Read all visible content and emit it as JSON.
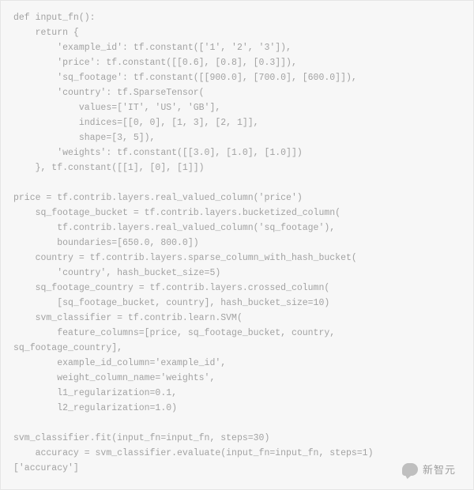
{
  "code_lines": [
    "def input_fn():",
    "    return {",
    "        'example_id': tf.constant(['1', '2', '3']),",
    "        'price': tf.constant([[0.6], [0.8], [0.3]]),",
    "        'sq_footage': tf.constant([[900.0], [700.0], [600.0]]),",
    "        'country': tf.SparseTensor(",
    "            values=['IT', 'US', 'GB'],",
    "            indices=[[0, 0], [1, 3], [2, 1]],",
    "            shape=[3, 5]),",
    "        'weights': tf.constant([[3.0], [1.0], [1.0]])",
    "    }, tf.constant([[1], [0], [1]])",
    "",
    "price = tf.contrib.layers.real_valued_column('price')",
    "    sq_footage_bucket = tf.contrib.layers.bucketized_column(",
    "        tf.contrib.layers.real_valued_column('sq_footage'),",
    "        boundaries=[650.0, 800.0])",
    "    country = tf.contrib.layers.sparse_column_with_hash_bucket(",
    "        'country', hash_bucket_size=5)",
    "    sq_footage_country = tf.contrib.layers.crossed_column(",
    "        [sq_footage_bucket, country], hash_bucket_size=10)",
    "    svm_classifier = tf.contrib.learn.SVM(",
    "        feature_columns=[price, sq_footage_bucket, country,",
    "sq_footage_country],",
    "        example_id_column='example_id',",
    "        weight_column_name='weights',",
    "        l1_regularization=0.1,",
    "        l2_regularization=1.0)",
    "",
    "svm_classifier.fit(input_fn=input_fn, steps=30)",
    "    accuracy = svm_classifier.evaluate(input_fn=input_fn, steps=1)",
    "['accuracy']"
  ],
  "watermark": {
    "label": "新智元"
  }
}
